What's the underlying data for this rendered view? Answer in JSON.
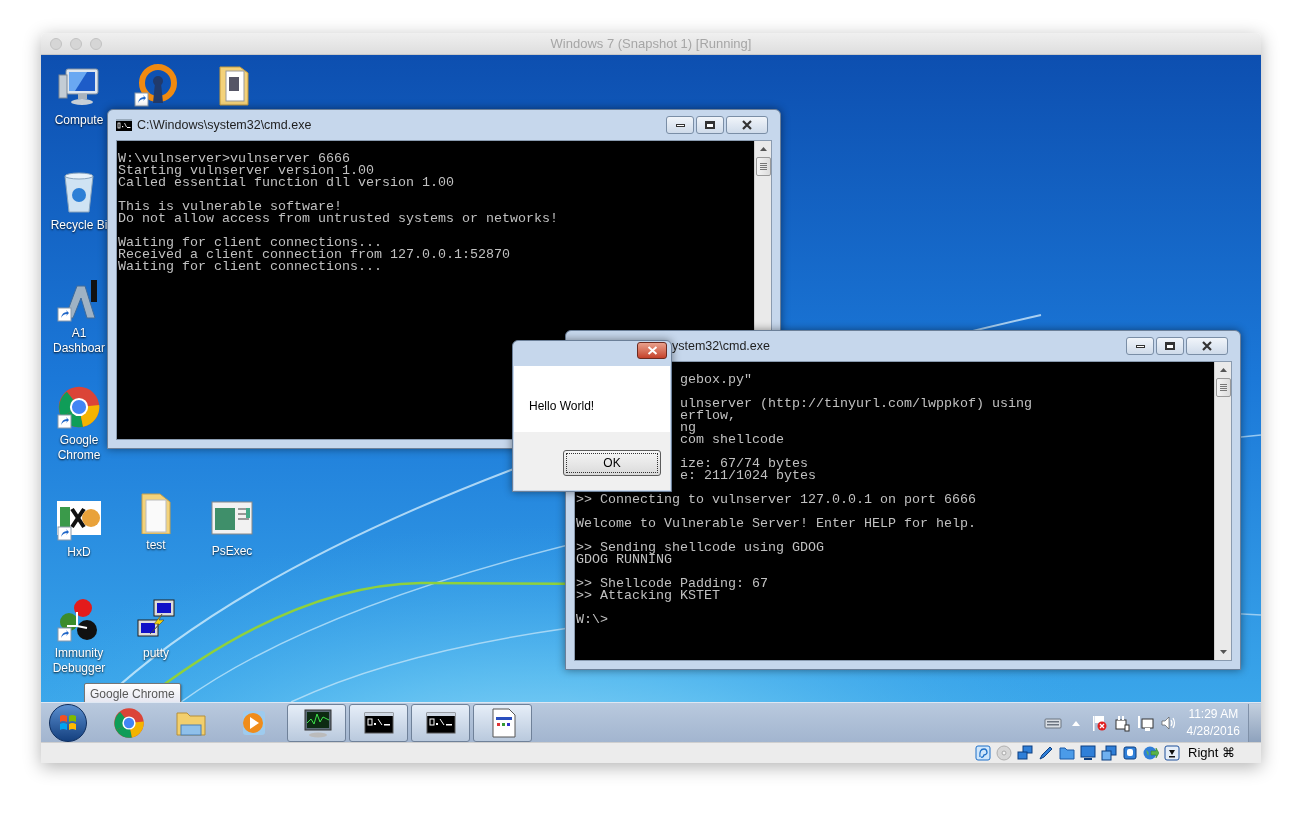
{
  "host_window": {
    "title": "Windows 7 (Snapshot 1) [Running]"
  },
  "desktop_icons": [
    {
      "kind": "computer",
      "shortcut": false,
      "label": [
        "Compute"
      ]
    },
    {
      "kind": "vpn",
      "shortcut": true
    },
    {
      "kind": "docs_folder",
      "shortcut": false
    },
    {
      "kind": "recycle_bin",
      "shortcut": false,
      "label": [
        "Recycle Bi"
      ]
    },
    {
      "kind": "a1",
      "shortcut": true,
      "label": [
        "A1",
        "Dashboar"
      ]
    },
    {
      "kind": "chrome",
      "shortcut": true,
      "label": [
        "Google",
        "Chrome"
      ]
    },
    {
      "kind": "hxd",
      "shortcut": true,
      "label": [
        "HxD"
      ]
    },
    {
      "kind": "folder",
      "shortcut": false,
      "label": [
        "test"
      ]
    },
    {
      "kind": "psexec",
      "shortcut": false,
      "label": [
        "PsExec"
      ]
    },
    {
      "kind": "immunity",
      "shortcut": true,
      "label": [
        "Immunity",
        "Debugger"
      ]
    },
    {
      "kind": "putty",
      "shortcut": false,
      "label": [
        "putty"
      ]
    }
  ],
  "tooltip": "Google Chrome",
  "windows": [
    {
      "title": "C:\\Windows\\system32\\cmd.exe",
      "blocks": [
        {
          "lines": [
            "W:\\vulnserver>vulnserver 6666",
            "Starting vulnserver version 1.00",
            "Called essential function dll version 1.00"
          ]
        },
        {
          "lines": [
            "This is vulnerable software!",
            "Do not allow access from untrusted systems or networks!"
          ]
        },
        {
          "lines": [
            "Waiting for client connections...",
            "Received a client connection from 127.0.0.1:52870",
            "Waiting for client connections..."
          ]
        }
      ]
    },
    {
      "title_behind_dialog": "ystem32\\cmd.exe",
      "blocks_behind_dialog": [
        {
          "lines": [
            "gebox.py\""
          ]
        },
        {
          "lines": [
            "ulnserver (http://tinyurl.com/lwppkof) using",
            "erflow,",
            "ng",
            "com shellcode"
          ]
        },
        {
          "lines": [
            "ize: 67/74 bytes",
            "e: 211/1024 bytes"
          ]
        }
      ],
      "blocks": [
        {
          "lines": [
            ">> Connecting to vulnserver 127.0.0.1 on port 6666"
          ]
        },
        {
          "lines": [
            "Welcome to Vulnerable Server! Enter HELP for help."
          ]
        },
        {
          "lines": [
            ">> Sending shellcode using GDOG",
            "GDOG RUNNING"
          ]
        },
        {
          "lines": [
            ">> Shellcode Padding: 67",
            ">> Attacking KSTET"
          ]
        },
        {
          "lines": [
            "W:\\>"
          ]
        }
      ]
    }
  ],
  "dialog": {
    "message": "Hello World!",
    "button": "OK"
  },
  "taskbar": {
    "pinned": [
      {
        "kind": "chrome"
      },
      {
        "kind": "explorer"
      },
      {
        "kind": "media_player"
      }
    ],
    "running": [
      {
        "kind": "perfmon"
      },
      {
        "kind": "cmd"
      },
      {
        "kind": "cmd"
      },
      {
        "kind": "document"
      }
    ],
    "tray": [
      {
        "kind": "keyboard"
      },
      {
        "kind": "show_hidden"
      },
      {
        "kind": "flag"
      },
      {
        "kind": "power"
      },
      {
        "kind": "network"
      },
      {
        "kind": "speaker"
      }
    ],
    "clock": {
      "time": "11:29 AM",
      "date": "4/28/2016"
    }
  },
  "status_bar": {
    "icons": [
      {
        "kind": "audio"
      },
      {
        "kind": "disc"
      },
      {
        "kind": "network"
      },
      {
        "kind": "usb"
      },
      {
        "kind": "shared_folder"
      },
      {
        "kind": "display"
      },
      {
        "kind": "screens"
      },
      {
        "kind": "cpu"
      },
      {
        "kind": "globe"
      },
      {
        "kind": "download"
      }
    ],
    "host_key": "Right ⌘"
  }
}
